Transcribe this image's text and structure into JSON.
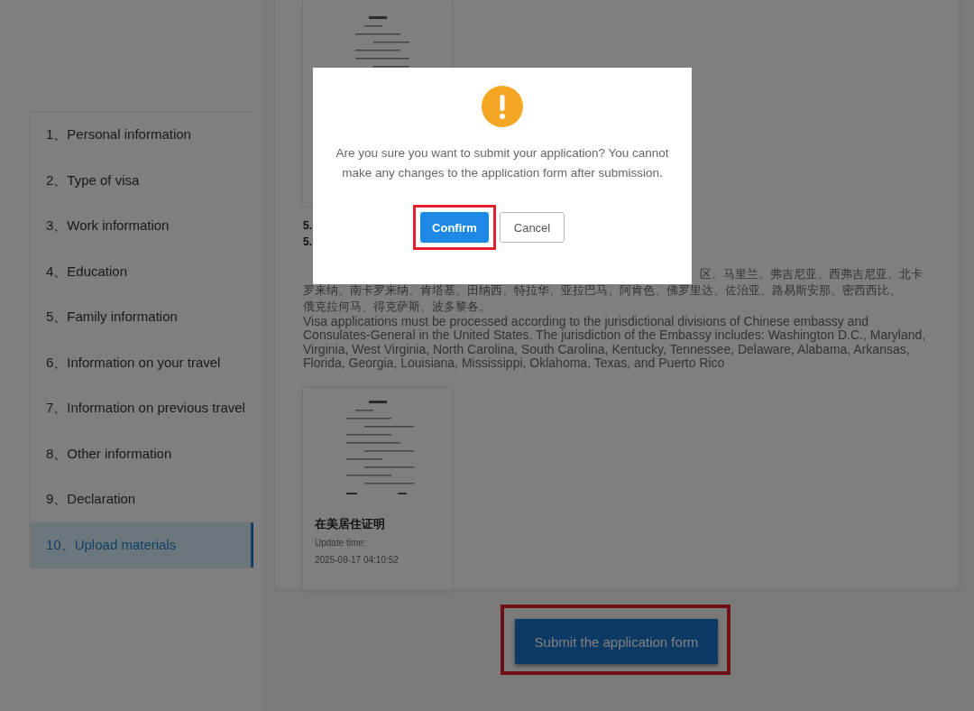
{
  "sidebar": {
    "items": [
      {
        "label": "1、Personal information",
        "selected": false
      },
      {
        "label": "2、Type of visa",
        "selected": false
      },
      {
        "label": "3、Work information",
        "selected": false
      },
      {
        "label": "4、Education",
        "selected": false
      },
      {
        "label": "5、Family information",
        "selected": false
      },
      {
        "label": "6、Information on your travel",
        "selected": false
      },
      {
        "label": "7、Information on previous travel",
        "selected": false
      },
      {
        "label": "8、Other information",
        "selected": false
      },
      {
        "label": "9、Declaration",
        "selected": false
      },
      {
        "label": "10、Upload materials",
        "selected": true
      }
    ]
  },
  "content": {
    "section_numbers": [
      "5.",
      "5."
    ],
    "chinese_note_lines": [
      "区、马里兰、弗吉尼亚、西弗吉尼亚、北卡",
      "罗来纳、南卡罗来纳、肯塔基、田纳西、特拉华、亚拉巴马、阿肯色、佛罗里达、佐治亚、路易斯安那、密西西比、",
      "俄克拉何马、得克萨斯、波多黎各。"
    ],
    "english_note": "Visa applications must be processed according to the jurisdictional divisions of Chinese embassy and Consulates-General in the United States. The jurisdiction of the Embassy includes: Washington D.C., Maryland, Virginia, West Virginia, North Carolina, South Carolina, Kentucky, Tennessee, Delaware, Alabama, Arkansas, Florida, Georgia, Louisiana, Mississippi, Oklahoma, Texas, and Puerto Rico",
    "document": {
      "title": "在美居住证明",
      "update_label": "Update time:",
      "update_time": "2025-09-17 04:10:52"
    }
  },
  "submit_button": {
    "label": "Submit the application form",
    "highlighted": true
  },
  "dialog": {
    "message": "Are you sure you want to submit your application? You cannot make any changes to the application form after submission.",
    "confirm": {
      "label": "Confirm",
      "highlighted": true
    },
    "cancel": {
      "label": "Cancel"
    }
  }
}
